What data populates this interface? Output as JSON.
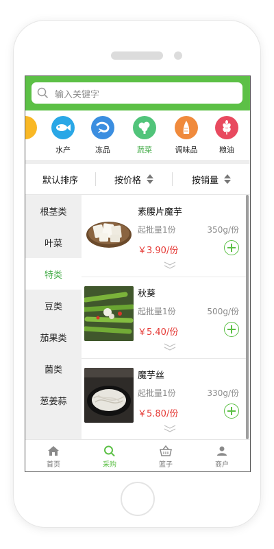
{
  "search": {
    "placeholder": "输入关键字"
  },
  "categories": [
    {
      "label": "",
      "icon": "partial-category-icon",
      "color": "#f9b825"
    },
    {
      "label": "水产",
      "icon": "fish-icon",
      "color": "#2aa7e6"
    },
    {
      "label": "冻品",
      "icon": "shrimp-icon",
      "color": "#3b8ee0"
    },
    {
      "label": "蔬菜",
      "icon": "vegetable-icon",
      "color": "#51c47a",
      "active": true
    },
    {
      "label": "调味品",
      "icon": "seasoning-icon",
      "color": "#f08a3c"
    },
    {
      "label": "粮油",
      "icon": "grain-icon",
      "color": "#e84a5f"
    }
  ],
  "sort": {
    "default_label": "默认排序",
    "price_label": "按价格",
    "sales_label": "按销量"
  },
  "sidebar": {
    "items": [
      {
        "label": "根茎类"
      },
      {
        "label": "叶菜"
      },
      {
        "label": "特类",
        "active": true
      },
      {
        "label": "豆类"
      },
      {
        "label": "茄果类"
      },
      {
        "label": "菌类"
      },
      {
        "label": "葱姜蒜"
      }
    ]
  },
  "products": [
    {
      "name": "素腰片魔芋",
      "min_order": "起批量1份",
      "weight": "350g/份",
      "price": "￥3.90/份",
      "image": "konjac-slices-image"
    },
    {
      "name": "秋葵",
      "min_order": "起批量1份",
      "weight": "500g/份",
      "price": "￥5.40/份",
      "image": "okra-dish-image"
    },
    {
      "name": "魔芋丝",
      "min_order": "起批量1份",
      "weight": "330g/份",
      "price": "￥5.80/份",
      "image": "konjac-noodles-image"
    }
  ],
  "bottom_nav": {
    "items": [
      {
        "label": "首页",
        "icon": "home-icon"
      },
      {
        "label": "采购",
        "icon": "search-icon",
        "active": true
      },
      {
        "label": "篮子",
        "icon": "basket-icon"
      },
      {
        "label": "商户",
        "icon": "user-icon"
      }
    ]
  },
  "colors": {
    "brand_green": "#5cc046",
    "price_red": "#e53935",
    "sidebar_bg": "#efefef"
  }
}
